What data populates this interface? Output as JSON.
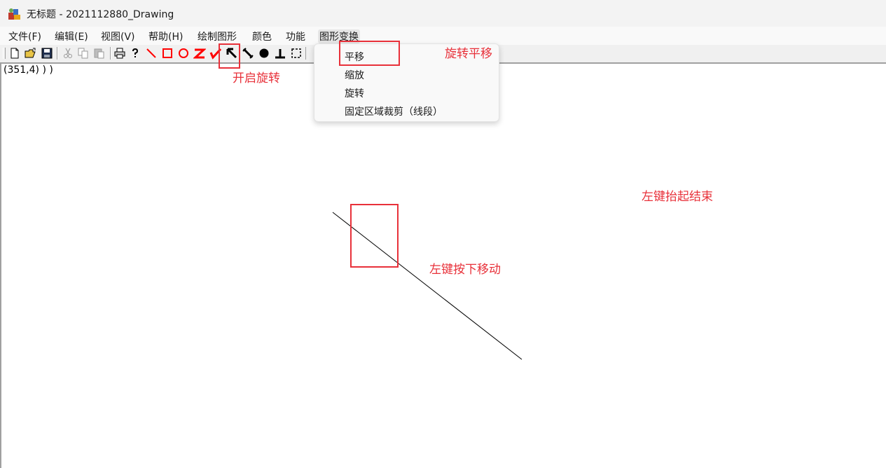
{
  "window": {
    "title": "无标题 - 2021112880_Drawing",
    "icon": "mfc-app-icon"
  },
  "menubar": {
    "items": [
      {
        "label": "文件(F)"
      },
      {
        "label": "编辑(E)"
      },
      {
        "label": "视图(V)"
      },
      {
        "label": "帮助(H)"
      },
      {
        "label": "绘制图形"
      },
      {
        "label": "颜色"
      },
      {
        "label": "功能"
      },
      {
        "label": "图形变换"
      }
    ]
  },
  "toolbar": {
    "buttons": [
      {
        "icon": "new-file-icon"
      },
      {
        "icon": "open-folder-icon"
      },
      {
        "icon": "save-icon"
      },
      {
        "icon": "cut-icon"
      },
      {
        "icon": "copy-icon"
      },
      {
        "icon": "paste-icon"
      },
      {
        "icon": "print-icon"
      },
      {
        "icon": "help-icon"
      },
      {
        "icon": "draw-line-icon"
      },
      {
        "icon": "draw-rectangle-icon"
      },
      {
        "icon": "draw-circle-icon"
      },
      {
        "icon": "draw-polyline-z-icon"
      },
      {
        "icon": "draw-polyline-check-icon"
      },
      {
        "icon": "rotate-arrow-icon"
      },
      {
        "icon": "fill-line-icon"
      },
      {
        "icon": "filled-circle-icon"
      },
      {
        "icon": "perpendicular-icon"
      },
      {
        "icon": "select-region-icon"
      }
    ]
  },
  "dropdown": {
    "parent": "图形变换",
    "items": [
      {
        "label": "平移"
      },
      {
        "label": "缩放"
      },
      {
        "label": "旋转"
      },
      {
        "label": "固定区域裁剪（线段）"
      }
    ]
  },
  "canvas": {
    "coord_readout": "(351,4) ) )"
  },
  "annotations": {
    "rotate_note": "旋转平移",
    "enable_rotate": "开启旋转",
    "left_release_end": "左键抬起结束",
    "left_press_move": "左键按下移动",
    "color": "#e8313a"
  },
  "colors": {
    "toolbar_draw_red": "#ff0000",
    "titlebar_bg": "#f3f3f3"
  }
}
